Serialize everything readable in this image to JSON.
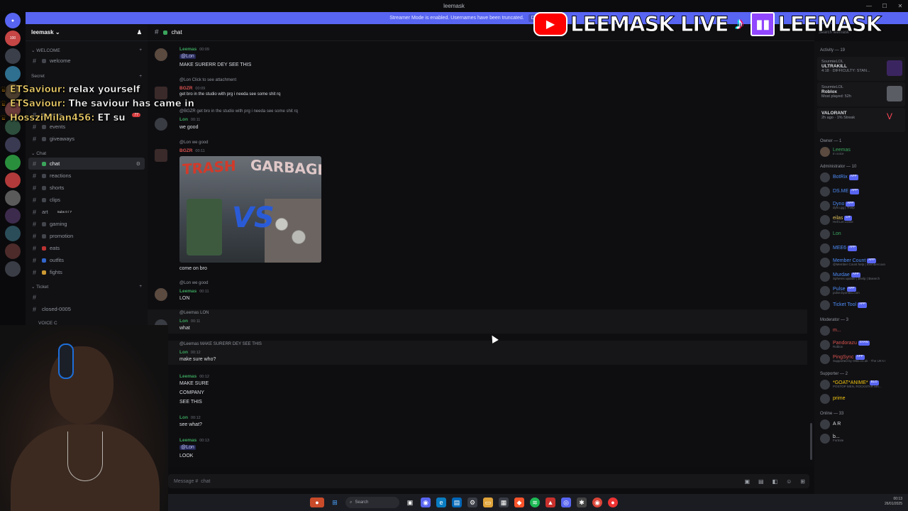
{
  "window": {
    "title": "leemask"
  },
  "banner": {
    "text": "Streamer Mode is enabled. Usernames have been truncated.",
    "button": "Disa"
  },
  "rail": {
    "top_badge": "100"
  },
  "guild": {
    "name": "leemask"
  },
  "categories": {
    "welcome": "WELCOME",
    "secret": "Secret",
    "chat": "Chat",
    "ticket": "Ticket",
    "voice": "VOICE C"
  },
  "channels": {
    "welcome": "welcome",
    "news": "news",
    "news_badge": "77",
    "events": "events",
    "giveaways": "giveaways",
    "chat": "chat",
    "reactions": "reactions",
    "shorts": "shorts",
    "clips": "clips",
    "art": "art",
    "art_note": "Subs 0 / 7",
    "gaming": "gaming",
    "promotion": "promotion",
    "eats": "eats",
    "outfits": "outfits",
    "fights": "fights",
    "closed": "closed-0005"
  },
  "chat_header": {
    "channel": "chat"
  },
  "messages": [
    {
      "name": "Leemas",
      "time": "00:09",
      "mention": "@Lon",
      "text": "MAKE SURERR DEY SEE THIS"
    },
    {
      "reply": "@Lon Click to see attachment",
      "name": "BGZR",
      "time": "00:09",
      "text": "get bro in the studio with prg i needa see some shit rq"
    },
    {
      "reply": "@BGZR get bro in the studio with prg i needa see some shit rq",
      "name": "Lon",
      "time": "00:11",
      "text": "we good"
    },
    {
      "reply": "@Lon we good",
      "name": "BGZR",
      "time": "00:11",
      "gif_text1": "TRASH",
      "gif_text2": "GARBAGE",
      "gif_vs": "VS",
      "text": "come on bro"
    },
    {
      "reply": "@Lon we good",
      "name": "Leemas",
      "time": "00:11",
      "text": "LON"
    },
    {
      "reply": "@Leemas LON",
      "name": "Lon",
      "time": "00:11",
      "text": "what"
    },
    {
      "reply": "@Leemas MAKE SURERR DEY SEE THIS",
      "name": "Lon",
      "time": "00:12",
      "text": "make sure who?"
    },
    {
      "name": "Leemas",
      "time": "00:12",
      "line1": "MAKE SURE",
      "line2": "COMPANY",
      "line3": "SEE THIS"
    },
    {
      "name": "Lon",
      "time": "00:12",
      "text": "see what?"
    },
    {
      "name": "Leemas",
      "time": "00:13",
      "mention": "@Lon",
      "text": "LOOK"
    }
  ],
  "input": {
    "placeholder": "Message #",
    "channel": "chat"
  },
  "members": {
    "search": "Search leemask",
    "activity_title": "Activity — 19",
    "activities": [
      {
        "user": "SourmieLOL",
        "game": "ULTRAKILL",
        "detail": "4:18 · DIFFICULTY: STAN..."
      },
      {
        "user": "SourmieLOL",
        "game": "Roblox",
        "detail": "Most played: 52h"
      },
      {
        "user": "",
        "game": "VALORANT",
        "detail": "2h ago · 1% Streak"
      }
    ],
    "owner_title": "Owner — 1",
    "owner": {
      "name": "Leemas",
      "sub": "In voice"
    },
    "admin_title": "Administrator — 10",
    "admins": [
      {
        "name": "BotRix",
        "tag": "APP",
        "sub": "",
        "color": "#4e8cf6"
      },
      {
        "name": "DS.ME",
        "tag": "APP",
        "sub": "",
        "color": "#4e8cf6"
      },
      {
        "name": "Dyno",
        "tag": "APP",
        "sub": "dyno.gg | ?help",
        "color": "#4e8cf6"
      },
      {
        "name": "eilas",
        "tag": "LIT",
        "sub": "Hell Let Loose",
        "color": "#e0c15a"
      },
      {
        "name": "Lon",
        "tag": "",
        "sub": "",
        "color": "#3ba55c"
      },
      {
        "name": "MEE6",
        "tag": "APP",
        "sub": "",
        "color": "#4e8cf6"
      },
      {
        "name": "Member Count",
        "tag": "APP",
        "sub": "@Member Count help | membercoun",
        "color": "#4e8cf6"
      },
      {
        "name": "Murdae",
        "tag": "APP",
        "sub": "Spheres update | $help | $search",
        "color": "#4e8cf6"
      },
      {
        "name": "Pulse",
        "tag": "APP",
        "sub": "pulse.byombo.com",
        "color": "#4e8cf6"
      },
      {
        "name": "Ticket Tool",
        "tag": "APP",
        "sub": "",
        "color": "#4e8cf6"
      }
    ],
    "mod_title": "Moderator — 3",
    "mods": [
      {
        "name": "m...",
        "tag": "",
        "sub": "",
        "color": "#d9534f"
      },
      {
        "name": "Pandorazu",
        "tag": "SYAN",
        "sub": "Roblox",
        "color": "#d9534f"
      },
      {
        "name": "PingSync",
        "tag": "APP",
        "sub": "Supported by O6lo.co.uk · The UK's I",
        "color": "#d9534f"
      }
    ],
    "supporter_title": "Supporter — 2",
    "supporters": [
      {
        "name": "*GOAT*ANIME*",
        "tag": "BLO",
        "sub": "POSTOP MEN, ROCKSTAR MA...",
        "color": "#f1c40f"
      },
      {
        "name": "prime",
        "tag": "",
        "sub": "",
        "color": "#f1c40f"
      }
    ],
    "online_title": "Online — 33",
    "online": [
      {
        "name": "A R",
        "sub": ""
      },
      {
        "name": "b...",
        "sub": "Fortnite"
      }
    ]
  },
  "overlay": {
    "youtube_text": "LEEMASK LIVE",
    "twitch_text": "LEEMASK",
    "chat": [
      {
        "user": "ETSaviour:",
        "text": "relax yourself"
      },
      {
        "user": "ETSaviour:",
        "text": "The saviour has came in"
      },
      {
        "user": "HossziMilan456:",
        "text": "ET su"
      }
    ]
  },
  "taskbar": {
    "search": "Search",
    "time": "00:13",
    "date": "26/01/2025"
  }
}
